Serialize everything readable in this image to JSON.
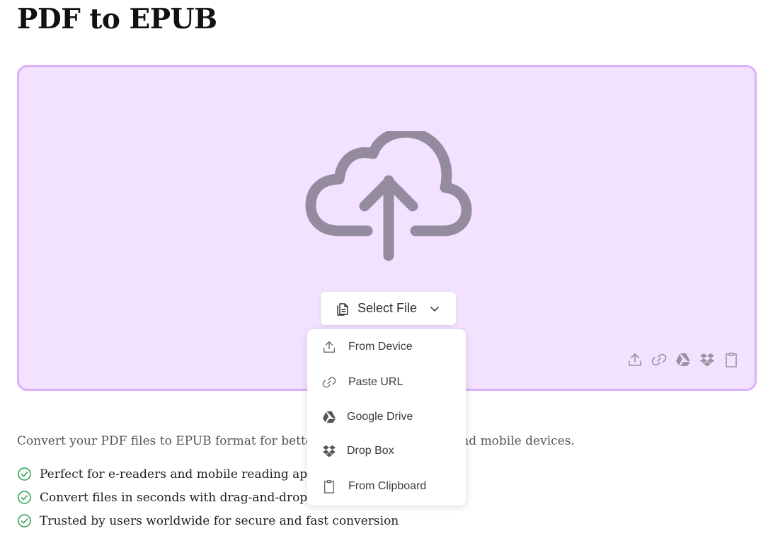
{
  "page": {
    "title": "PDF to EPUB",
    "description": "Convert your PDF files to EPUB format for better reading on e-readers and mobile devices."
  },
  "dropzone": {
    "background": "#f3e2ff",
    "border_color": "#dcb0fa",
    "upload_icon": "cloud-upload-icon",
    "select_button_label": "Select File",
    "corner_icons": [
      "upload-icon",
      "link-icon",
      "google-drive-icon",
      "dropbox-icon",
      "clipboard-icon"
    ]
  },
  "dropdown": {
    "items": [
      {
        "label": "From Device",
        "icon": "upload-icon"
      },
      {
        "label": "Paste URL",
        "icon": "link-icon"
      },
      {
        "label": "Google Drive",
        "icon": "google-drive-icon"
      },
      {
        "label": "Drop Box",
        "icon": "dropbox-icon"
      },
      {
        "label": "From Clipboard",
        "icon": "clipboard-icon"
      }
    ]
  },
  "features": [
    "Perfect for e-readers and mobile reading apps",
    "Convert files in seconds with drag-and-drop simplicity",
    "Trusted by users worldwide for secure and fast conversion"
  ],
  "colors": {
    "accent_check": "#2e9e4f",
    "icon_gray": "#958b9e"
  }
}
